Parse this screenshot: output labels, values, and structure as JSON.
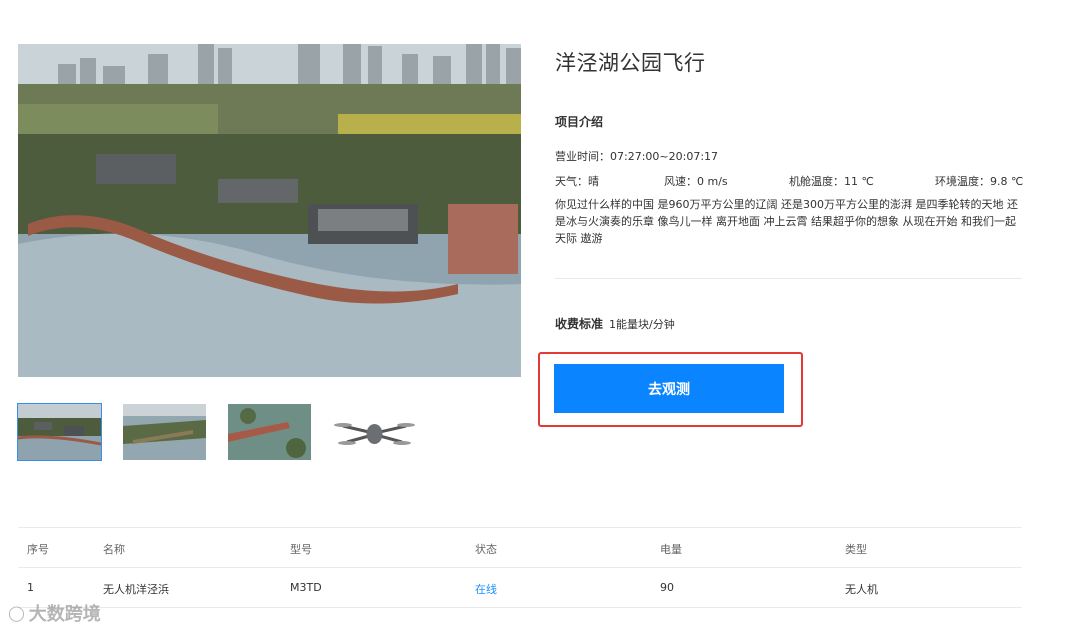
{
  "main_image": {
    "description_icon": "park-aerial-photo"
  },
  "thumbnails": [
    {
      "icon": "aerial-photo-1",
      "active": true
    },
    {
      "icon": "aerial-photo-2",
      "active": false
    },
    {
      "icon": "aerial-photo-3",
      "active": false
    },
    {
      "icon": "drone-photo",
      "active": false
    }
  ],
  "detail": {
    "title": "洋泾湖公园飞行",
    "section_label": "项目介绍",
    "hours": "营业时间：07:27:00~20:07:17",
    "weather": "天气：晴",
    "wind": "风速：0 m/s",
    "cabin_temp": "机舱温度：11 ℃",
    "env_temp": "环境温度：9.8 ℃",
    "description": "你见过什么样的中国 是960万平方公里的辽阔 还是300万平方公里的澎湃 是四季轮转的天地 还是冰与火演奏的乐章 像鸟儿一样 离开地面 冲上云霄 结果超乎你的想象 从现在开始 和我们一起 天际 遨游",
    "fee_label": "收费标准",
    "fee_value": "1能量块/分钟",
    "button_label": "去观测"
  },
  "table": {
    "headers": [
      "序号",
      "名称",
      "型号",
      "状态",
      "电量",
      "类型"
    ],
    "rows": [
      {
        "index": "1",
        "name": "无人机洋泾浜",
        "model": "M3TD",
        "status": "在线",
        "battery": "90",
        "type": "无人机"
      }
    ]
  },
  "watermark": {
    "text": "大数跨境"
  },
  "colors": {
    "accent": "#0a84ff",
    "highlight": "#e53935",
    "online": "#1e90ff"
  }
}
